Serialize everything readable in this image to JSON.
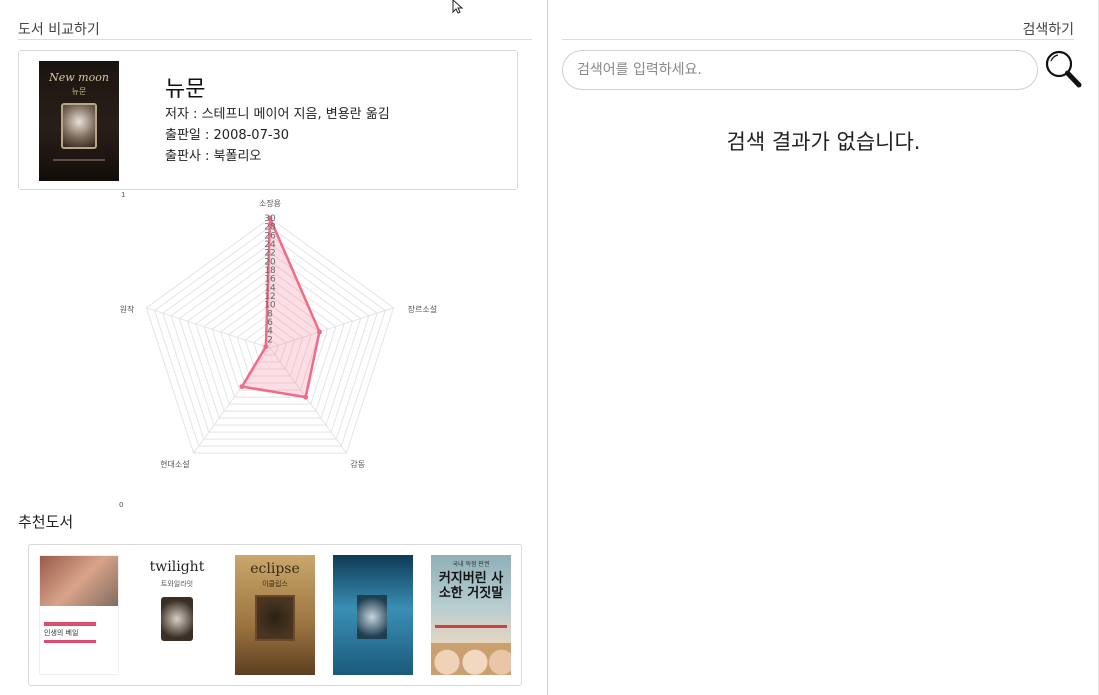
{
  "compare": {
    "section_title": "도서 비교하기",
    "book": {
      "cover_title_en": "New moon",
      "cover_title_ko": "뉴문",
      "title": "뉴문",
      "author_line": "저자 : 스테프니 메이어 지음, 변용란 옮김",
      "date_line": "출판일 : 2008-07-30",
      "publisher_line": "출판사 : 북폴리오"
    }
  },
  "chart_data": {
    "type": "radar",
    "axes": [
      "소장용",
      "장르소설",
      "감동",
      "현대소설",
      "원작"
    ],
    "r_ticks": [
      "2",
      "4",
      "6",
      "8",
      "10",
      "12",
      "14",
      "16",
      "18",
      "20",
      "22",
      "24",
      "26",
      "28",
      "30"
    ],
    "rlim": [
      0,
      30
    ],
    "corner_labels": {
      "top_left": "1",
      "bottom_left": "0"
    },
    "series": [
      {
        "values": [
          30,
          12,
          14,
          11,
          1
        ],
        "color": "#f06b86"
      }
    ],
    "grid": true
  },
  "recommend": {
    "title": "추천도서",
    "books": [
      {
        "title": "인생의 베일"
      },
      {
        "title": "twilight",
        "subtitle": "트와일라잇"
      },
      {
        "title": "eclipse",
        "subtitle": "이클립스"
      },
      {
        "title": ""
      },
      {
        "title": "커지버린 사소한 거짓말",
        "subtitle": "국내 독점 판권"
      }
    ]
  },
  "search": {
    "section_title": "검색하기",
    "placeholder": "검색어를 입력하세요.",
    "empty_message": "검색 결과가 없습니다."
  },
  "icons": {
    "search": "magnifier-icon",
    "cursor": "mouse-cursor-icon"
  }
}
